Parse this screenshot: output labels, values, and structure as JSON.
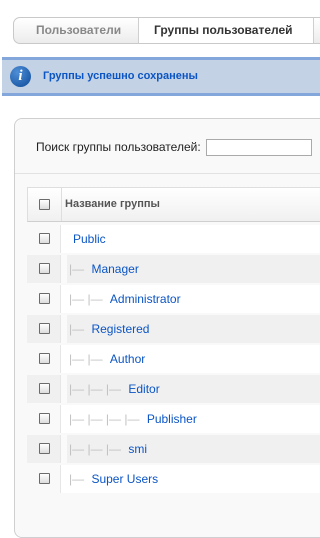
{
  "tabs": [
    {
      "label": "Пользователи"
    },
    {
      "label": "Группы пользователей"
    }
  ],
  "message": {
    "icon": "info-icon",
    "text": "Группы успешно сохранены"
  },
  "filter": {
    "search_label": "Поиск группы пользователей:",
    "search_value": ""
  },
  "table": {
    "header": {
      "title": "Название группы"
    },
    "rows": [
      {
        "indent": "",
        "name": "Public"
      },
      {
        "indent": "|— ",
        "name": "Manager"
      },
      {
        "indent": "|— |— ",
        "name": "Administrator"
      },
      {
        "indent": "|— ",
        "name": "Registered"
      },
      {
        "indent": "|— |— ",
        "name": "Author"
      },
      {
        "indent": "|— |— |— ",
        "name": "Editor"
      },
      {
        "indent": "|— |— |— |— ",
        "name": "Publisher"
      },
      {
        "indent": "|— |— |— ",
        "name": "smi"
      },
      {
        "indent": "|— ",
        "name": "Super Users"
      }
    ]
  },
  "colors": {
    "link": "#0b55c4",
    "message_bg": "#c3d2e5",
    "message_border": "#84a7db"
  }
}
